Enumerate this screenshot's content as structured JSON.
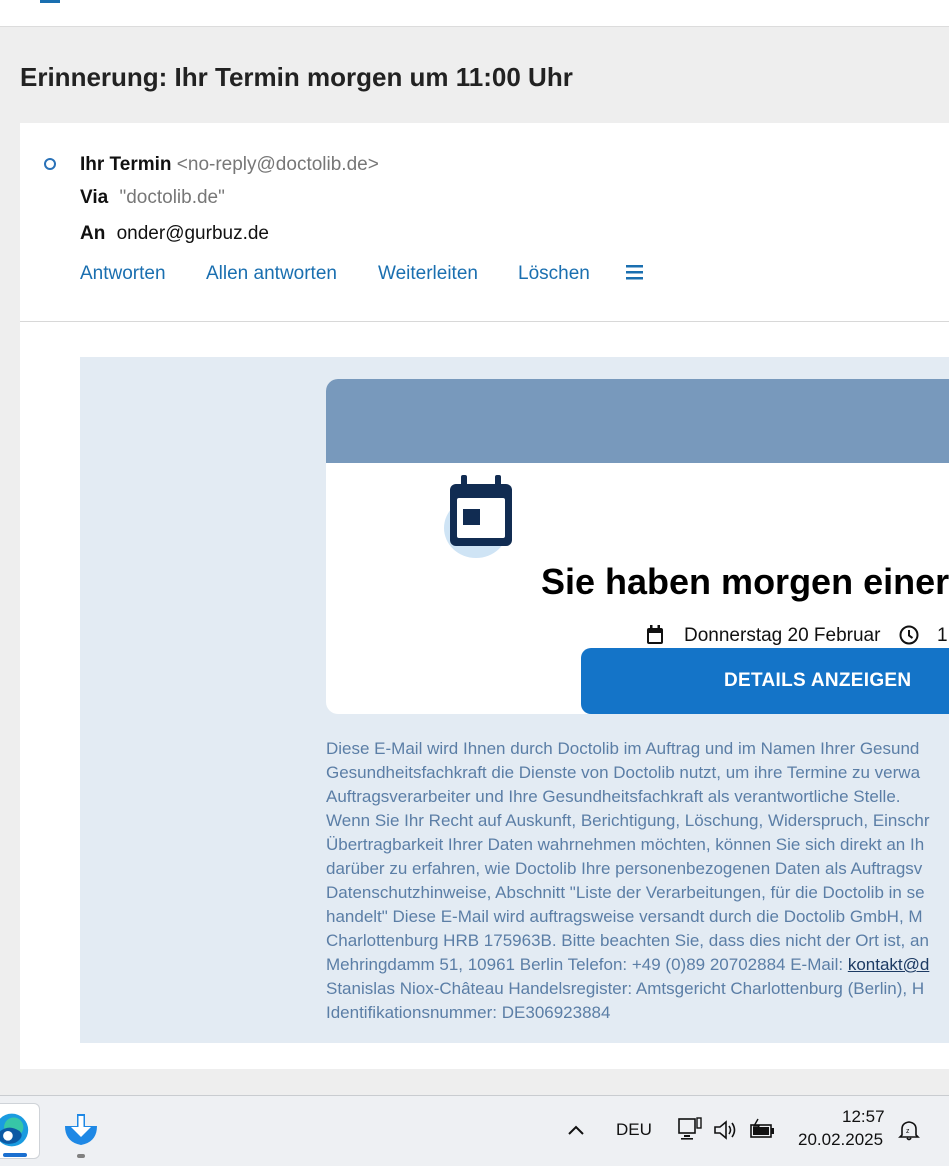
{
  "subject": "Erinnerung: Ihr Termin morgen um 11:00 Uhr",
  "header": {
    "from_name": "Ihr Termin",
    "from_address": "<no-reply@doctolib.de>",
    "via_label": "Via",
    "via_value": "\"doctolib.de\"",
    "to_label": "An",
    "to_value": "onder@gurbuz.de"
  },
  "actions": {
    "reply": "Antworten",
    "reply_all": "Allen antworten",
    "forward": "Weiterleiten",
    "delete": "Löschen"
  },
  "email": {
    "title": "Sie haben morgen einer",
    "date": "Donnerstag 20 Februar",
    "time": "1",
    "button": "DETAILS ANZEIGEN",
    "footer_lines": [
      "Diese E-Mail wird Ihnen durch Doctolib im Auftrag und im Namen Ihrer Gesund",
      "Gesundheitsfachkraft die Dienste von Doctolib nutzt, um ihre Termine zu verwa",
      "Auftragsverarbeiter und Ihre Gesundheitsfachkraft als verantwortliche Stelle.",
      "Wenn Sie Ihr Recht auf Auskunft, Berichtigung, Löschung, Widerspruch, Einschr",
      "Übertragbarkeit Ihrer Daten wahrnehmen möchten, können Sie sich direkt an Ih",
      "darüber zu erfahren, wie Doctolib Ihre personenbezogenen Daten als Auftragsv",
      "Datenschutzhinweise, Abschnitt \"Liste der Verarbeitungen, für die Doctolib in se",
      "handelt\" Diese E-Mail wird auftragsweise versandt durch die Doctolib GmbH, M",
      "Charlottenburg HRB 175963B. Bitte beachten Sie, dass dies nicht der Ort ist, an"
    ],
    "footer_line_10_prefix": "Mehringdamm 51, 10961 Berlin Telefon: +49 (0)89 20702884 E-Mail: ",
    "footer_link": "kontakt@d",
    "footer_lines_end": [
      "Stanislas Niox-Château Handelsregister: Amtsgericht Charlottenburg (Berlin), H",
      "Identifikationsnummer: DE306923884"
    ]
  },
  "taskbar": {
    "language": "DEU",
    "time": "12:57",
    "date": "20.02.2025"
  },
  "colors": {
    "accent": "#1a6fb0",
    "card_header": "#7899bc",
    "body_bg": "#e3ebf3",
    "button": "#1474c8"
  }
}
